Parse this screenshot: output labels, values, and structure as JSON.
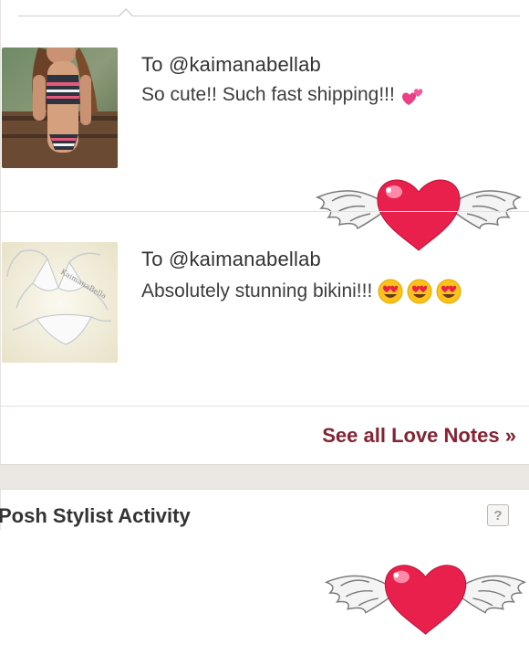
{
  "love_notes": [
    {
      "recipient": "To @kaimanabellab",
      "message": "So cute!! Such fast shipping!!!",
      "emojis": [
        "two-hearts-emoji"
      ],
      "thumbnail": "bikini-photo-striped",
      "sticker": "winged-heart"
    },
    {
      "recipient": "To @kaimanabellab",
      "message": "Absolutely stunning bikini!!!",
      "emojis": [
        "heart-eyes-emoji",
        "heart-eyes-emoji",
        "heart-eyes-emoji"
      ],
      "thumbnail": "bikini-photo-white",
      "watermark": "KaimanaBella",
      "sticker": "winged-heart"
    }
  ],
  "see_all_label": "See all Love Notes »",
  "activity_section": {
    "title": "Posh Stylist Activity",
    "help_label": "?"
  },
  "colors": {
    "link": "#822432",
    "heart": "#e8204b",
    "section_band": "#ebe8e3"
  }
}
